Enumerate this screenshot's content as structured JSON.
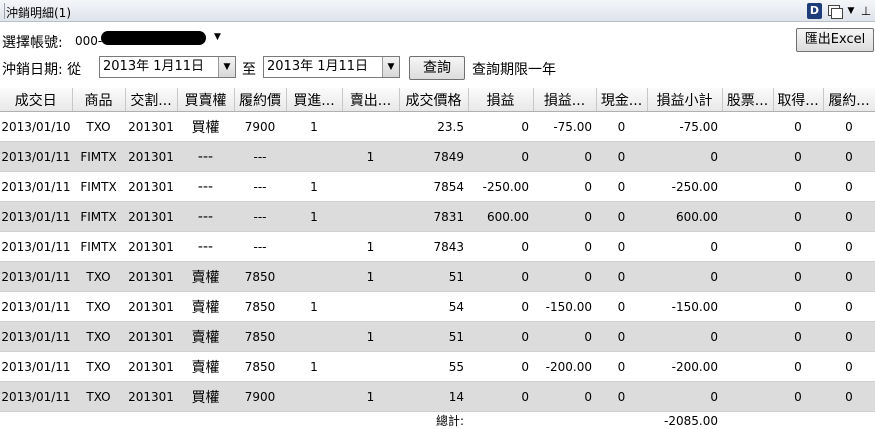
{
  "window": {
    "title": "沖銷明細(1)",
    "d_icon": "D",
    "icons": [
      "d-app-icon",
      "window-restore-icon",
      "dropdown-triangle-icon",
      "pin-icon"
    ]
  },
  "filters": {
    "account_label": "選擇帳號:",
    "account_value": "000-",
    "date_label": "沖銷日期: 從",
    "date_from": "2013年  1月11日",
    "to_label": "至",
    "date_to": "2013年  1月11日",
    "query_button": "查詢",
    "query_note": "查詢期限一年",
    "excel_button": "匯出Excel"
  },
  "table": {
    "columns": [
      "成交日",
      "商品",
      "交割...",
      "買賣權",
      "履約價",
      "買進...",
      "賣出...",
      "成交價格",
      "損益",
      "損益...",
      "現金...",
      "損益小計",
      "股票...",
      "取得...",
      "履約..."
    ],
    "rows": [
      [
        "2013/01/10",
        "TXO",
        "201301",
        "買權",
        "7900",
        "1",
        "",
        "23.5",
        "0",
        "-75.00",
        "0",
        "-75.00",
        "",
        "0",
        "0"
      ],
      [
        "2013/01/11",
        "FIMTX",
        "201301",
        "---",
        "---",
        "",
        "1",
        "7849",
        "0",
        "0",
        "0",
        "0",
        "",
        "0",
        "0"
      ],
      [
        "2013/01/11",
        "FIMTX",
        "201301",
        "---",
        "---",
        "1",
        "",
        "7854",
        "-250.00",
        "0",
        "0",
        "-250.00",
        "",
        "0",
        "0"
      ],
      [
        "2013/01/11",
        "FIMTX",
        "201301",
        "---",
        "---",
        "1",
        "",
        "7831",
        "600.00",
        "0",
        "0",
        "600.00",
        "",
        "0",
        "0"
      ],
      [
        "2013/01/11",
        "FIMTX",
        "201301",
        "---",
        "---",
        "",
        "1",
        "7843",
        "0",
        "0",
        "0",
        "0",
        "",
        "0",
        "0"
      ],
      [
        "2013/01/11",
        "TXO",
        "201301",
        "賣權",
        "7850",
        "",
        "1",
        "51",
        "0",
        "0",
        "0",
        "0",
        "",
        "0",
        "0"
      ],
      [
        "2013/01/11",
        "TXO",
        "201301",
        "賣權",
        "7850",
        "1",
        "",
        "54",
        "0",
        "-150.00",
        "0",
        "-150.00",
        "",
        "0",
        "0"
      ],
      [
        "2013/01/11",
        "TXO",
        "201301",
        "賣權",
        "7850",
        "",
        "1",
        "51",
        "0",
        "0",
        "0",
        "0",
        "",
        "0",
        "0"
      ],
      [
        "2013/01/11",
        "TXO",
        "201301",
        "賣權",
        "7850",
        "1",
        "",
        "55",
        "0",
        "-200.00",
        "0",
        "-200.00",
        "",
        "0",
        "0"
      ],
      [
        "2013/01/11",
        "TXO",
        "201301",
        "買權",
        "7900",
        "",
        "1",
        "14",
        "0",
        "0",
        "0",
        "0",
        "",
        "0",
        "0"
      ]
    ],
    "total_label": "總計:",
    "total_value": "-2085.00"
  }
}
